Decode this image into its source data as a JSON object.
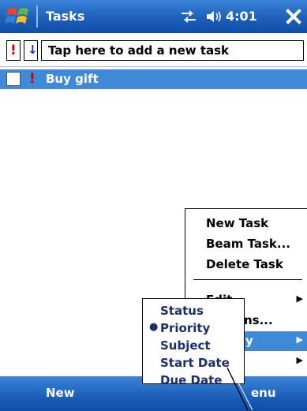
{
  "titlebar": {
    "app_title": "Tasks",
    "clock": "4:01",
    "start_icon": "windows-flag-icon",
    "connectivity_icon": "connectivity-icon",
    "volume_icon": "speaker-icon",
    "close_icon": "close-icon",
    "close_label": "X"
  },
  "entry_bar": {
    "priority_glyph": "!",
    "sort_glyph": "↓",
    "new_task_prompt": "Tap here to add a new task"
  },
  "tasks": [
    {
      "name": "Buy gift",
      "priority_glyph": "!",
      "checked": false,
      "selected": true
    }
  ],
  "command_bar": {
    "left_label": "New",
    "right_label_visible": "enu"
  },
  "main_menu": {
    "items": [
      {
        "label": "New Task"
      },
      {
        "label": "Beam Task..."
      },
      {
        "label": "Delete Task"
      },
      {
        "label": "Edit",
        "has_submenu": true
      },
      {
        "label": "ns...",
        "has_submenu": false
      },
      {
        "label": "y",
        "has_submenu": true,
        "highlighted": true
      },
      {
        "label": "",
        "has_submenu": true
      }
    ]
  },
  "sort_submenu": {
    "items": [
      {
        "label": "Status",
        "checked": false
      },
      {
        "label": "Priority",
        "checked": true
      },
      {
        "label": "Subject",
        "checked": false
      },
      {
        "label": "Start Date",
        "checked": false
      },
      {
        "label": "Due Date",
        "checked": false
      }
    ]
  },
  "colors": {
    "titlebar": "#1b5fb9",
    "selection": "#3e8ad6",
    "priority_red": "#d00000",
    "submenu_text": "#1a2f6b"
  }
}
